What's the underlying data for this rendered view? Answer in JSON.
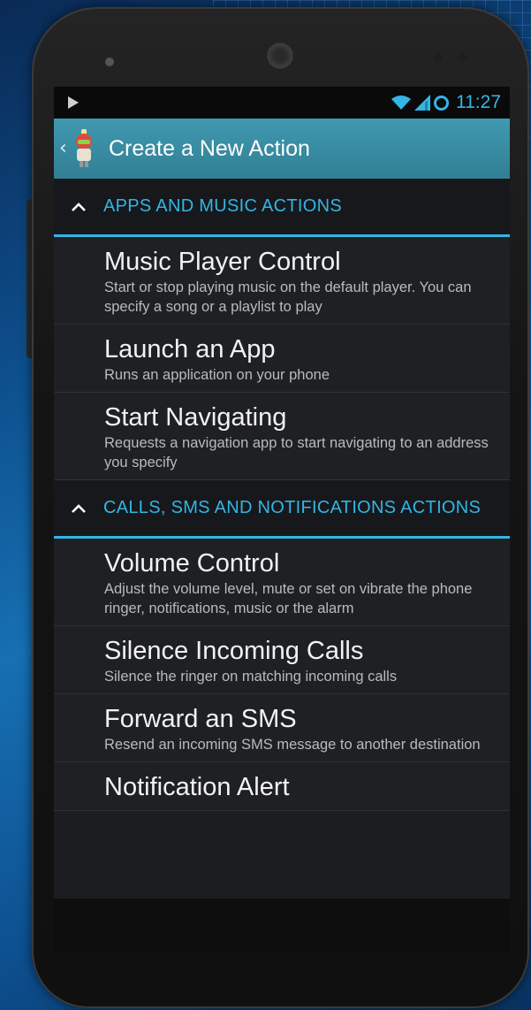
{
  "status_bar": {
    "time": "11:27"
  },
  "action_bar": {
    "title": "Create a New Action"
  },
  "sections": [
    {
      "header": "APPS AND MUSIC ACTIONS",
      "items": [
        {
          "title": "Music Player Control",
          "description": "Start or stop playing music on the default player. You can specify a song or a playlist to play"
        },
        {
          "title": "Launch an App",
          "description": "Runs an application on your phone"
        },
        {
          "title": "Start Navigating",
          "description": "Requests a navigation app to start navigating to an address you specify"
        }
      ]
    },
    {
      "header": "CALLS, SMS AND NOTIFICATIONS ACTIONS",
      "items": [
        {
          "title": "Volume Control",
          "description": "Adjust the volume level, mute or set on vibrate the phone ringer, notifications, music or the alarm"
        },
        {
          "title": "Silence Incoming Calls",
          "description": "Silence the ringer on matching incoming calls"
        },
        {
          "title": "Forward an SMS",
          "description": "Resend an incoming SMS message to another destination"
        },
        {
          "title": "Notification Alert",
          "description": ""
        }
      ]
    }
  ],
  "colors": {
    "accent": "#33b5e5",
    "action_bar": "#3a8ba0",
    "background": "#1e2024"
  }
}
